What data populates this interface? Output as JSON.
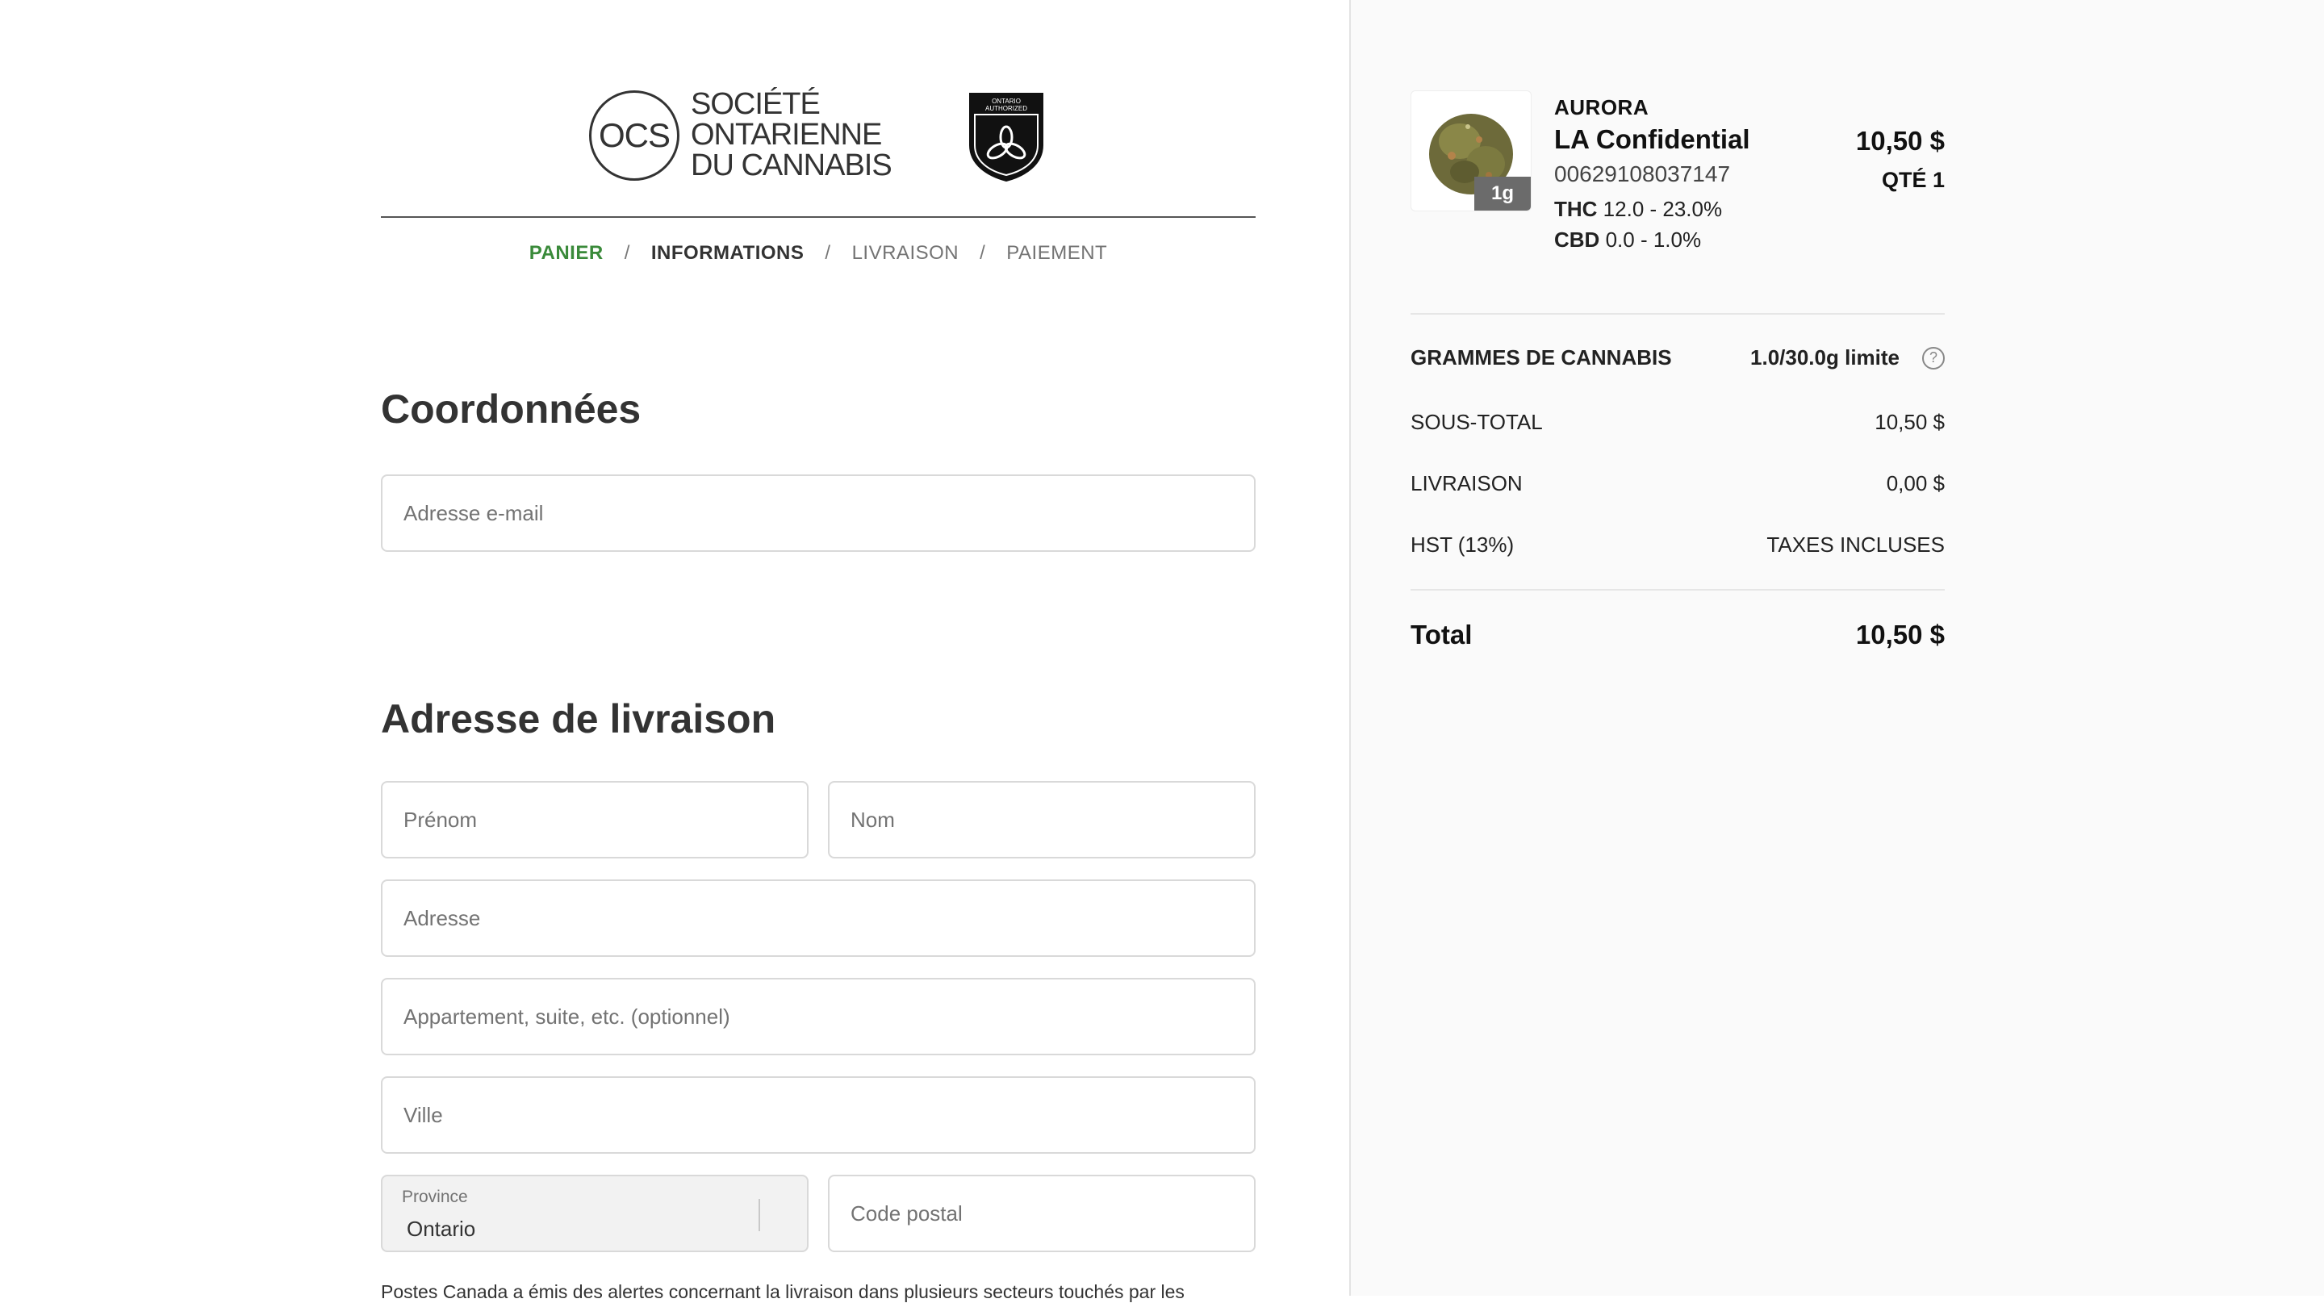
{
  "logo": {
    "ocs_abbrev": "OCS",
    "ocs_line1": "SOCIÉTÉ",
    "ocs_line2": "ONTARIENNE",
    "ocs_line3": "DU CANNABIS",
    "badge_line1": "ONTARIO",
    "badge_line2": "AUTHORIZED"
  },
  "breadcrumb": [
    {
      "label": "PANIER"
    },
    {
      "label": "INFORMATIONS"
    },
    {
      "label": "LIVRAISON"
    },
    {
      "label": "PAIEMENT"
    }
  ],
  "breadcrumb_sep": "/",
  "contact": {
    "heading": "Coordonnées",
    "email_placeholder": "Adresse e-mail"
  },
  "shipping": {
    "heading": "Adresse de livraison",
    "first_name_placeholder": "Prénom",
    "last_name_placeholder": "Nom",
    "address_placeholder": "Adresse",
    "apt_placeholder": "Appartement, suite, etc. (optionnel)",
    "city_placeholder": "Ville",
    "province_label": "Province",
    "province_value": "Ontario",
    "postal_placeholder": "Code postal",
    "notice": "Postes Canada a émis des alertes concernant la livraison dans plusieurs secteurs touchés par les"
  },
  "product": {
    "brand": "AURORA",
    "name": "LA Confidential",
    "sku": "00629108037147",
    "thc_label": "THC",
    "thc_value": "12.0 - 23.0%",
    "cbd_label": "CBD",
    "cbd_value": "0.0 - 1.0%",
    "size_badge": "1g",
    "price": "10,50 $",
    "qty": "QTÉ 1"
  },
  "summary": {
    "grams_label": "GRAMMES DE CANNABIS",
    "grams_value": "1.0/30.0g limite",
    "help_symbol": "?",
    "subtotal_label": "SOUS-TOTAL",
    "subtotal_value": "10,50 $",
    "shipping_label": "LIVRAISON",
    "shipping_value": "0,00 $",
    "hst_label": "HST (13%)",
    "hst_value": "TAXES INCLUSES",
    "total_label": "Total",
    "total_value": "10,50 $"
  },
  "colors": {
    "active_step": "#3a8a3a",
    "sidebar_bg": "#fafafa"
  }
}
